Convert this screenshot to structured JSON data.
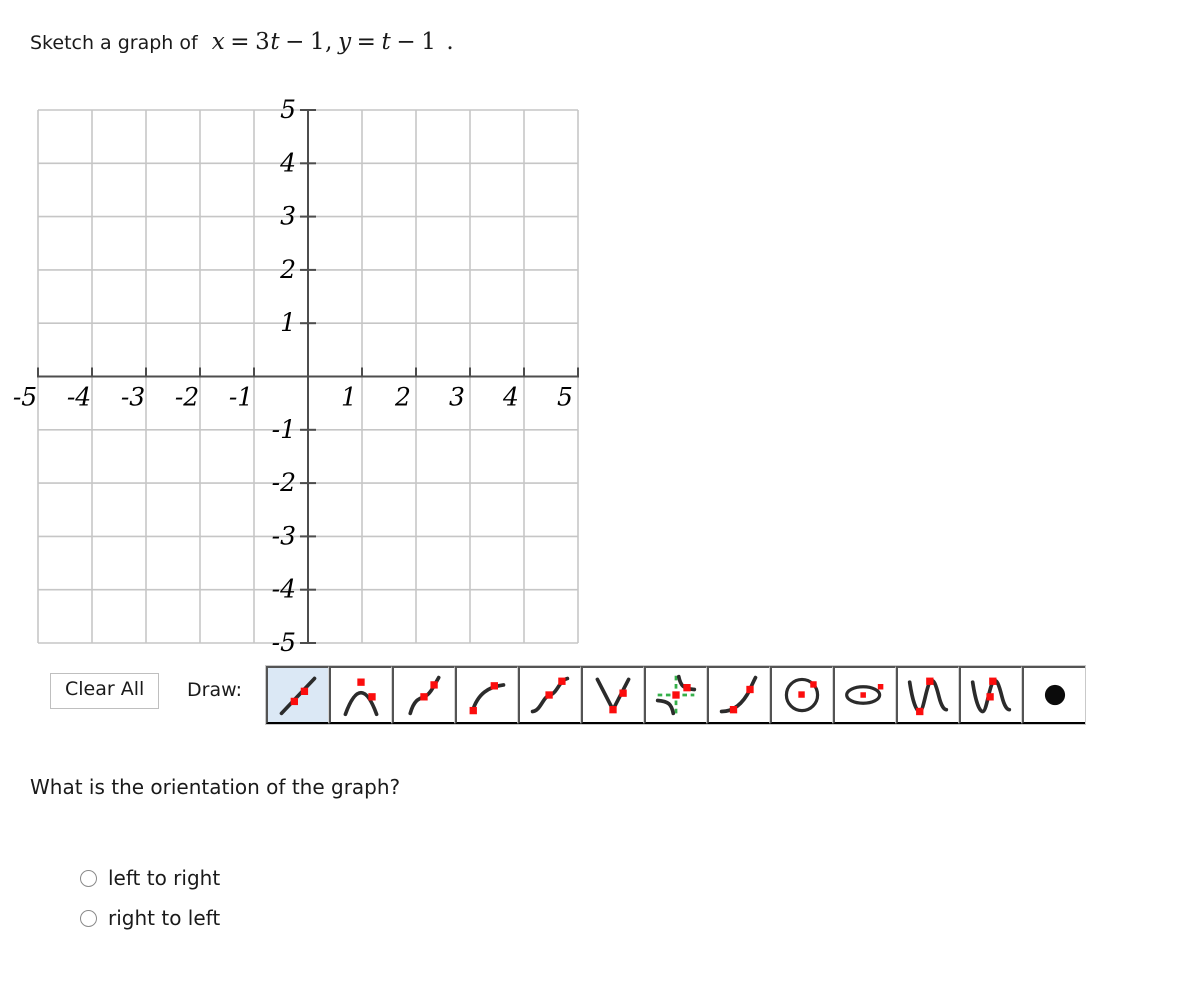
{
  "prompt": {
    "lead": "Sketch a graph of",
    "equation": "x = 3t − 1, y = t − 1",
    "equation_parts": {
      "x_var": "x",
      "eq1": "=",
      "coef": "3",
      "t1": "t",
      "minus1": "−",
      "one1": "1",
      "comma": ",",
      "y_var": "y",
      "eq2": "=",
      "t2": "t",
      "minus2": "−",
      "one2": "1"
    },
    "period": "."
  },
  "graph": {
    "x_labels": [
      "-5",
      "-4",
      "-3",
      "-2",
      "-1",
      "1",
      "2",
      "3",
      "4",
      "5"
    ],
    "y_labels": [
      "5",
      "4",
      "3",
      "2",
      "1",
      "-1",
      "-2",
      "-3",
      "-4",
      "-5"
    ],
    "x_min": -5,
    "x_max": 5,
    "y_min": -5,
    "y_max": 5,
    "grid_color": "#c6c6c6",
    "axis_color": "#4d4d4d",
    "has_grid": true,
    "plotted_curves": []
  },
  "toolbar": {
    "clear_all_label": "Clear All",
    "draw_label": "Draw:",
    "selected_tool_index": 0,
    "selected_tool_color": "#dbe8f5",
    "point_color": "#fb0d0d",
    "curve_color": "#2b2b2b",
    "asymptote_color": "#35b04a",
    "tools": [
      {
        "name": "line-tool",
        "icon": "line-icon",
        "selected": true
      },
      {
        "name": "parabola-tool",
        "icon": "parabola-icon",
        "selected": false
      },
      {
        "name": "cubic-tool",
        "icon": "cubic-icon",
        "selected": false
      },
      {
        "name": "radical-tool",
        "icon": "radical-icon",
        "selected": false
      },
      {
        "name": "sigmoid-tool",
        "icon": "sigmoid-icon",
        "selected": false
      },
      {
        "name": "absolute-value-tool",
        "icon": "absolute-value-icon",
        "selected": false
      },
      {
        "name": "rational-tool",
        "icon": "hyperbola-asymptote-icon",
        "selected": false
      },
      {
        "name": "exponential-tool",
        "icon": "exponential-icon",
        "selected": false
      },
      {
        "name": "circle-tool",
        "icon": "circle-icon",
        "selected": false
      },
      {
        "name": "ellipse-tool",
        "icon": "ellipse-icon",
        "selected": false
      },
      {
        "name": "sine-tool",
        "icon": "sine-wave-icon",
        "selected": false
      },
      {
        "name": "cosine-tool",
        "icon": "cosine-wave-icon",
        "selected": false
      },
      {
        "name": "point-tool",
        "icon": "filled-dot-icon",
        "selected": false
      }
    ]
  },
  "question": {
    "text": "What is the orientation of the graph?",
    "choices": [
      {
        "label": "left to right",
        "selected": false
      },
      {
        "label": "right to left",
        "selected": false
      }
    ]
  }
}
